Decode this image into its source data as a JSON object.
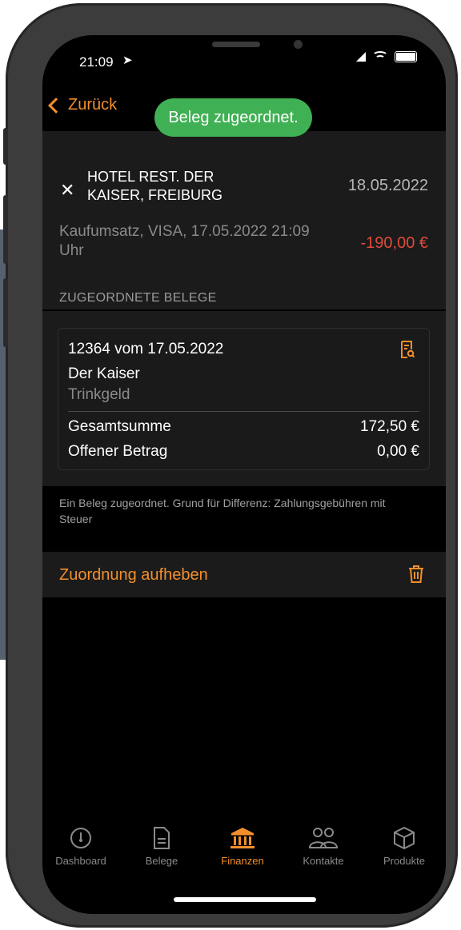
{
  "status": {
    "time": "21:09"
  },
  "nav": {
    "back_label": "Zurück"
  },
  "toast": {
    "message": "Beleg zugeordnet."
  },
  "transaction": {
    "merchant": "HOTEL REST. DER KAISER, FREIBURG",
    "date": "18.05.2022",
    "description": "Kaufumsatz, VISA, 17.05.2022 21:09 Uhr",
    "amount": "-190,00 €"
  },
  "section": {
    "header": "ZUGEORDNETE BELEGE"
  },
  "receipt": {
    "title": "12364 vom 17.05.2022",
    "vendor": "Der Kaiser",
    "note": "Trinkgeld",
    "total_label": "Gesamtsumme",
    "total_value": "172,50 €",
    "open_label": "Offener Betrag",
    "open_value": "0,00 €"
  },
  "footnote": "Ein Beleg zugeordnet. Grund für Differenz: Zahlungsgebühren mit Steuer",
  "action": {
    "unassign_label": "Zuordnung aufheben"
  },
  "tabs": [
    {
      "label": "Dashboard",
      "icon": "speedometer-icon"
    },
    {
      "label": "Belege",
      "icon": "document-icon"
    },
    {
      "label": "Finanzen",
      "icon": "bank-icon",
      "active": true
    },
    {
      "label": "Kontakte",
      "icon": "people-icon"
    },
    {
      "label": "Produkte",
      "icon": "box-icon"
    }
  ],
  "colors": {
    "accent": "#f28f2c",
    "negative": "#e04a3b",
    "toast": "#3fb053"
  }
}
